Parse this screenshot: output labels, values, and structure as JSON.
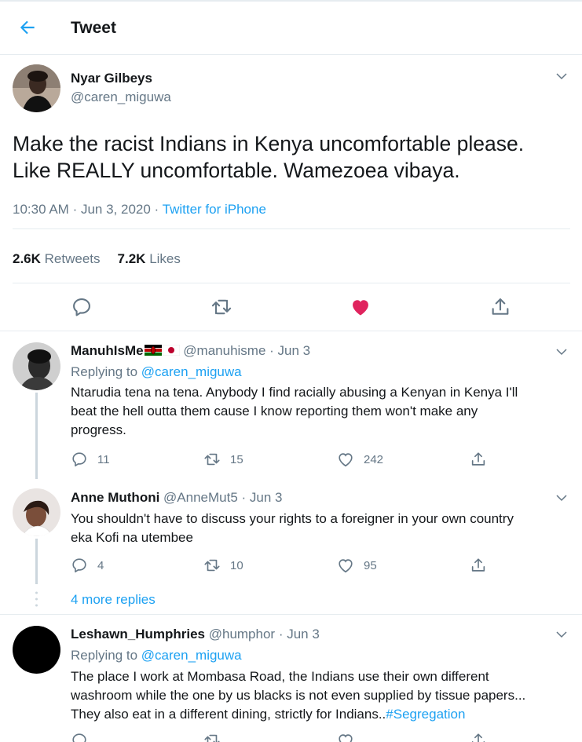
{
  "header": {
    "title": "Tweet",
    "back_icon": "arrow-left-icon"
  },
  "main_tweet": {
    "name": "Nyar Gilbeys",
    "handle": "@caren_miguwa",
    "text_line1": "Make the racist Indians in Kenya uncomfortable please.",
    "text_line2": "Like REALLY uncomfortable. Wamezoea vibaya.",
    "time": "10:30 AM",
    "date": "Jun 3, 2020",
    "source": "Twitter for iPhone",
    "retweets_count": "2.6K",
    "retweets_label": "Retweets",
    "likes_count": "7.2K",
    "likes_label": "Likes",
    "liked": true
  },
  "replies": [
    {
      "name": "ManuhIsMe",
      "handle": "@manuhisme",
      "date": "Jun 3",
      "replying_prefix": "Replying to",
      "replying_to": "@caren_miguwa",
      "text_line1": "Ntarudia tena na tena. Anybody I find racially abusing a Kenyan in Kenya I'll",
      "text_line2": "beat the hell outta them cause I know reporting them won't make any",
      "text_line3": "progress.",
      "reply_count": "11",
      "retweet_count": "15",
      "like_count": "242"
    },
    {
      "name": "Anne Muthoni",
      "handle": "@AnneMut5",
      "date": "Jun 3",
      "text_line1": "You shouldn't have to discuss your  rights to a foreigner in your own country",
      "text_line2": "eka Kofi na utembee",
      "reply_count": "4",
      "retweet_count": "10",
      "like_count": "95"
    },
    {
      "name": "Leshawn_Humphries",
      "handle": "@humphor",
      "date": "Jun 3",
      "replying_prefix": "Replying to",
      "replying_to": "@caren_miguwa",
      "text_line1": "The place I work at Mombasa Road, the Indians use their own different",
      "text_line2": "washroom while the one by us blacks is not even supplied by tissue papers...",
      "text_line3_prefix": "They also eat in a different dining, strictly for Indians..",
      "hashtag": "#Segregation"
    }
  ],
  "more_replies": "4 more replies",
  "colors": {
    "accent": "#1da1f2",
    "like": "#e0245e",
    "muted": "#657786",
    "border": "#e6ecf0"
  }
}
